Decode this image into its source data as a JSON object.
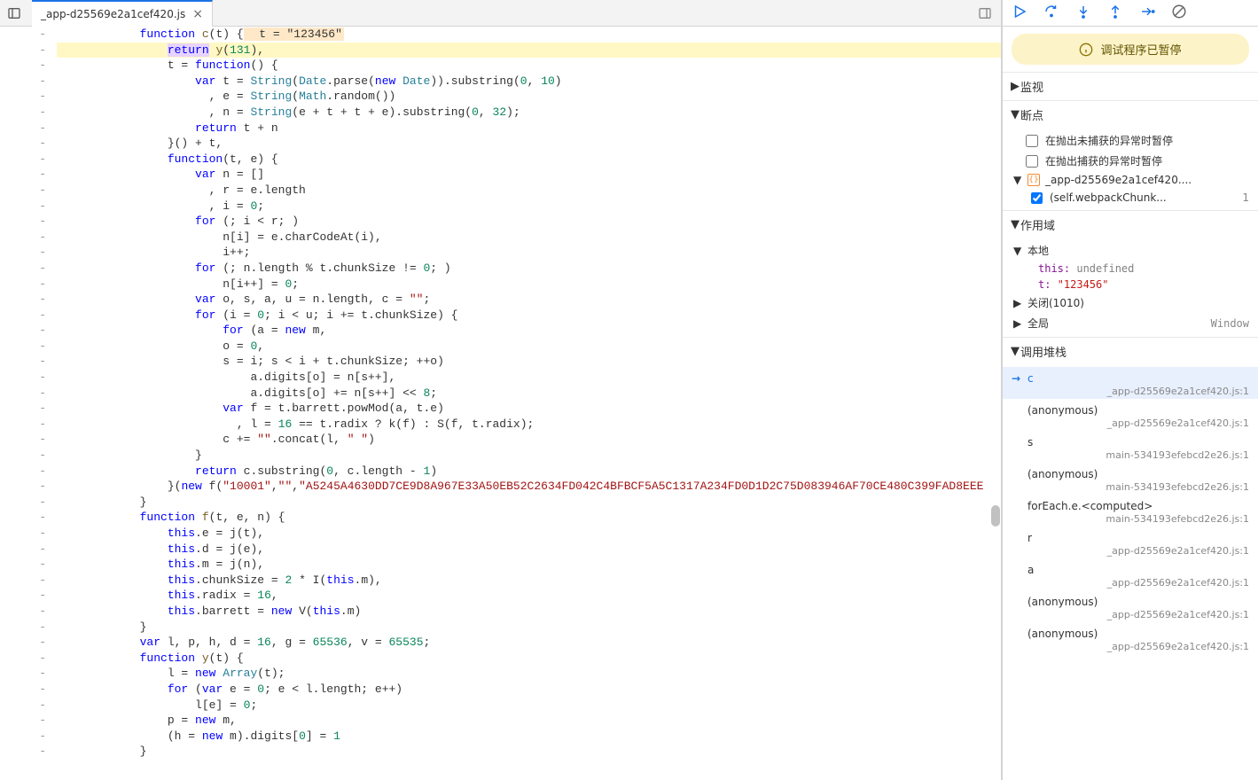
{
  "tab": {
    "title": "_app-d25569e2a1cef420.js",
    "close": "×"
  },
  "exec_hint": "t = \"123456\"",
  "code": [
    {
      "pre": "            ",
      "tokens": [
        [
          "kw",
          "function"
        ],
        [
          "op",
          " "
        ],
        [
          "fn",
          "c"
        ],
        [
          "op",
          "(t) {"
        ]
      ],
      "exec_hint": true
    },
    {
      "hl": "exec",
      "pre": "                ",
      "tokens": [
        [
          "return",
          "return"
        ],
        [
          "op",
          " "
        ],
        [
          "fn",
          "y"
        ],
        [
          "op",
          "("
        ],
        [
          "num",
          "131"
        ],
        [
          "op",
          "),"
        ]
      ]
    },
    {
      "pre": "                ",
      "tokens": [
        [
          "op",
          "t = "
        ],
        [
          "kw",
          "function"
        ],
        [
          "op",
          "() {"
        ]
      ]
    },
    {
      "pre": "                    ",
      "tokens": [
        [
          "kw",
          "var"
        ],
        [
          "op",
          " t = "
        ],
        [
          "type",
          "String"
        ],
        [
          "op",
          "("
        ],
        [
          "type",
          "Date"
        ],
        [
          "op",
          ".parse("
        ],
        [
          "new",
          "new"
        ],
        [
          "op",
          " "
        ],
        [
          "type",
          "Date"
        ],
        [
          "op",
          ")).substring("
        ],
        [
          "num",
          "0"
        ],
        [
          "op",
          ", "
        ],
        [
          "num",
          "10"
        ],
        [
          "op",
          ")"
        ]
      ]
    },
    {
      "pre": "                      ",
      "tokens": [
        [
          "op",
          ", e = "
        ],
        [
          "type",
          "String"
        ],
        [
          "op",
          "("
        ],
        [
          "type",
          "Math"
        ],
        [
          "op",
          ".random())"
        ]
      ]
    },
    {
      "pre": "                      ",
      "tokens": [
        [
          "op",
          ", n = "
        ],
        [
          "type",
          "String"
        ],
        [
          "op",
          "(e + t + t + e).substring("
        ],
        [
          "num",
          "0"
        ],
        [
          "op",
          ", "
        ],
        [
          "num",
          "32"
        ],
        [
          "op",
          ");"
        ]
      ]
    },
    {
      "pre": "                    ",
      "tokens": [
        [
          "kw",
          "return"
        ],
        [
          "op",
          " t + n"
        ]
      ]
    },
    {
      "pre": "                ",
      "tokens": [
        [
          "op",
          "}() + t,"
        ]
      ]
    },
    {
      "pre": "                ",
      "tokens": [
        [
          "kw",
          "function"
        ],
        [
          "op",
          "(t, e) {"
        ]
      ]
    },
    {
      "pre": "                    ",
      "tokens": [
        [
          "kw",
          "var"
        ],
        [
          "op",
          " n = []"
        ]
      ]
    },
    {
      "pre": "                      ",
      "tokens": [
        [
          "op",
          ", r = e.length"
        ]
      ]
    },
    {
      "pre": "                      ",
      "tokens": [
        [
          "op",
          ", i = "
        ],
        [
          "num",
          "0"
        ],
        [
          "op",
          ";"
        ]
      ]
    },
    {
      "pre": "                    ",
      "tokens": [
        [
          "kw",
          "for"
        ],
        [
          "op",
          " (; i < r; )"
        ]
      ]
    },
    {
      "pre": "                        ",
      "tokens": [
        [
          "op",
          "n[i] = e.charCodeAt(i),"
        ]
      ]
    },
    {
      "pre": "                        ",
      "tokens": [
        [
          "op",
          "i++;"
        ]
      ]
    },
    {
      "pre": "                    ",
      "tokens": [
        [
          "kw",
          "for"
        ],
        [
          "op",
          " (; n.length % t.chunkSize != "
        ],
        [
          "num",
          "0"
        ],
        [
          "op",
          "; )"
        ]
      ]
    },
    {
      "pre": "                        ",
      "tokens": [
        [
          "op",
          "n[i++] = "
        ],
        [
          "num",
          "0"
        ],
        [
          "op",
          ";"
        ]
      ]
    },
    {
      "pre": "                    ",
      "tokens": [
        [
          "kw",
          "var"
        ],
        [
          "op",
          " o, s, a, u = n.length, c = "
        ],
        [
          "str",
          "\"\""
        ],
        [
          "op",
          ";"
        ]
      ]
    },
    {
      "pre": "                    ",
      "tokens": [
        [
          "kw",
          "for"
        ],
        [
          "op",
          " (i = "
        ],
        [
          "num",
          "0"
        ],
        [
          "op",
          "; i < u; i += t.chunkSize) {"
        ]
      ]
    },
    {
      "pre": "                        ",
      "tokens": [
        [
          "kw",
          "for"
        ],
        [
          "op",
          " (a = "
        ],
        [
          "new",
          "new"
        ],
        [
          "op",
          " m,"
        ]
      ]
    },
    {
      "pre": "                        ",
      "tokens": [
        [
          "op",
          "o = "
        ],
        [
          "num",
          "0"
        ],
        [
          "op",
          ","
        ]
      ]
    },
    {
      "pre": "                        ",
      "tokens": [
        [
          "op",
          "s = i; s < i + t.chunkSize; ++o)"
        ]
      ]
    },
    {
      "pre": "                            ",
      "tokens": [
        [
          "op",
          "a.digits[o] = n[s++],"
        ]
      ]
    },
    {
      "pre": "                            ",
      "tokens": [
        [
          "op",
          "a.digits[o] += n[s++] << "
        ],
        [
          "num",
          "8"
        ],
        [
          "op",
          ";"
        ]
      ]
    },
    {
      "pre": "                        ",
      "tokens": [
        [
          "kw",
          "var"
        ],
        [
          "op",
          " f = t.barrett.powMod(a, t.e)"
        ]
      ]
    },
    {
      "pre": "                          ",
      "tokens": [
        [
          "op",
          ", l = "
        ],
        [
          "num",
          "16"
        ],
        [
          "op",
          " == t.radix ? k(f) : S(f, t.radix);"
        ]
      ]
    },
    {
      "pre": "                        ",
      "tokens": [
        [
          "op",
          "c += "
        ],
        [
          "str",
          "\"\""
        ],
        [
          "op",
          ".concat(l, "
        ],
        [
          "str",
          "\" \""
        ],
        [
          "op",
          ")"
        ]
      ]
    },
    {
      "pre": "                    ",
      "tokens": [
        [
          "op",
          "}"
        ]
      ]
    },
    {
      "pre": "                    ",
      "tokens": [
        [
          "kw",
          "return"
        ],
        [
          "op",
          " c.substring("
        ],
        [
          "num",
          "0"
        ],
        [
          "op",
          ", c.length - "
        ],
        [
          "num",
          "1"
        ],
        [
          "op",
          ")"
        ]
      ]
    },
    {
      "pre": "                ",
      "tokens": [
        [
          "op",
          "}("
        ],
        [
          "new",
          "new"
        ],
        [
          "op",
          " f("
        ],
        [
          "str",
          "\"10001\""
        ],
        [
          "op",
          ","
        ],
        [
          "str",
          "\"\""
        ],
        [
          "op",
          ","
        ],
        [
          "str",
          "\"A5245A4630DD7CE9D8A967E33A50EB52C2634FD042C4BFBCF5A5C1317A234FD0D1D2C75D083946AF70CE480C399FAD8EEE"
        ]
      ]
    },
    {
      "pre": "            ",
      "tokens": [
        [
          "op",
          "}"
        ]
      ]
    },
    {
      "pre": "            ",
      "tokens": [
        [
          "kw",
          "function"
        ],
        [
          "op",
          " "
        ],
        [
          "fn",
          "f"
        ],
        [
          "op",
          "(t, e, n) {"
        ]
      ]
    },
    {
      "pre": "                ",
      "tokens": [
        [
          "kw",
          "this"
        ],
        [
          "op",
          ".e = j(t),"
        ]
      ]
    },
    {
      "pre": "                ",
      "tokens": [
        [
          "kw",
          "this"
        ],
        [
          "op",
          ".d = j(e),"
        ]
      ]
    },
    {
      "pre": "                ",
      "tokens": [
        [
          "kw",
          "this"
        ],
        [
          "op",
          ".m = j(n),"
        ]
      ]
    },
    {
      "pre": "                ",
      "tokens": [
        [
          "kw",
          "this"
        ],
        [
          "op",
          ".chunkSize = "
        ],
        [
          "num",
          "2"
        ],
        [
          "op",
          " * I("
        ],
        [
          "kw",
          "this"
        ],
        [
          "op",
          ".m),"
        ]
      ]
    },
    {
      "pre": "                ",
      "tokens": [
        [
          "kw",
          "this"
        ],
        [
          "op",
          ".radix = "
        ],
        [
          "num",
          "16"
        ],
        [
          "op",
          ","
        ]
      ]
    },
    {
      "pre": "                ",
      "tokens": [
        [
          "kw",
          "this"
        ],
        [
          "op",
          ".barrett = "
        ],
        [
          "new",
          "new"
        ],
        [
          "op",
          " V("
        ],
        [
          "kw",
          "this"
        ],
        [
          "op",
          ".m)"
        ]
      ]
    },
    {
      "pre": "            ",
      "tokens": [
        [
          "op",
          "}"
        ]
      ]
    },
    {
      "pre": "            ",
      "tokens": [
        [
          "kw",
          "var"
        ],
        [
          "op",
          " l, p, h, d = "
        ],
        [
          "num",
          "16"
        ],
        [
          "op",
          ", g = "
        ],
        [
          "num",
          "65536"
        ],
        [
          "op",
          ", v = "
        ],
        [
          "num",
          "65535"
        ],
        [
          "op",
          ";"
        ]
      ]
    },
    {
      "pre": "            ",
      "tokens": [
        [
          "kw",
          "function"
        ],
        [
          "op",
          " "
        ],
        [
          "fn",
          "y"
        ],
        [
          "op",
          "(t) {"
        ]
      ]
    },
    {
      "pre": "                ",
      "tokens": [
        [
          "op",
          "l = "
        ],
        [
          "new",
          "new"
        ],
        [
          "op",
          " "
        ],
        [
          "type",
          "Array"
        ],
        [
          "op",
          "(t);"
        ]
      ]
    },
    {
      "pre": "                ",
      "tokens": [
        [
          "kw",
          "for"
        ],
        [
          "op",
          " ("
        ],
        [
          "kw",
          "var"
        ],
        [
          "op",
          " e = "
        ],
        [
          "num",
          "0"
        ],
        [
          "op",
          "; e < l.length; e++)"
        ]
      ]
    },
    {
      "pre": "                    ",
      "tokens": [
        [
          "op",
          "l[e] = "
        ],
        [
          "num",
          "0"
        ],
        [
          "op",
          ";"
        ]
      ]
    },
    {
      "pre": "                ",
      "tokens": [
        [
          "op",
          "p = "
        ],
        [
          "new",
          "new"
        ],
        [
          "op",
          " m,"
        ]
      ]
    },
    {
      "pre": "                ",
      "tokens": [
        [
          "op",
          "(h = "
        ],
        [
          "new",
          "new"
        ],
        [
          "op",
          " m).digits["
        ],
        [
          "num",
          "0"
        ],
        [
          "op",
          "] = "
        ],
        [
          "num",
          "1"
        ]
      ]
    },
    {
      "pre": "            ",
      "tokens": [
        [
          "op",
          "}"
        ]
      ]
    }
  ],
  "debug": {
    "paused_banner": "调试程序已暂停",
    "btn_resume": "Resume",
    "btn_step_over": "Step over",
    "btn_step_into": "Step into",
    "btn_step_out": "Step out",
    "btn_step": "Step",
    "btn_deactivate": "Deactivate breakpoints",
    "sections": {
      "watch": "监视",
      "breakpoints": "断点",
      "scope": "作用域",
      "callstack": "调用堆栈"
    },
    "bp": {
      "uncaught": "在抛出未捕获的异常时暂停",
      "caught": "在抛出捕获的异常时暂停",
      "file": "_app-d25569e2a1cef420....",
      "sub": "(self.webpackChunk...",
      "sub_line": "1"
    },
    "scope": {
      "local": "本地",
      "var_this_name": "this:",
      "var_this_val": "undefined",
      "var_t_name": "t:",
      "var_t_val": "\"123456\"",
      "closure": "关闭(1010)",
      "global": "全局",
      "global_val": "Window"
    },
    "callstack": [
      {
        "name": "c",
        "src": "_app-d25569e2a1cef420.js:1",
        "active": true
      },
      {
        "name": "(anonymous)",
        "src": "_app-d25569e2a1cef420.js:1"
      },
      {
        "name": "s",
        "src": "main-534193efebcd2e26.js:1"
      },
      {
        "name": "(anonymous)",
        "src": "main-534193efebcd2e26.js:1"
      },
      {
        "name": "forEach.e.<computed>",
        "src": "main-534193efebcd2e26.js:1"
      },
      {
        "name": "r",
        "src": "_app-d25569e2a1cef420.js:1"
      },
      {
        "name": "a",
        "src": "_app-d25569e2a1cef420.js:1"
      },
      {
        "name": "(anonymous)",
        "src": "_app-d25569e2a1cef420.js:1"
      },
      {
        "name": "(anonymous)",
        "src": "_app-d25569e2a1cef420.js:1"
      }
    ]
  }
}
